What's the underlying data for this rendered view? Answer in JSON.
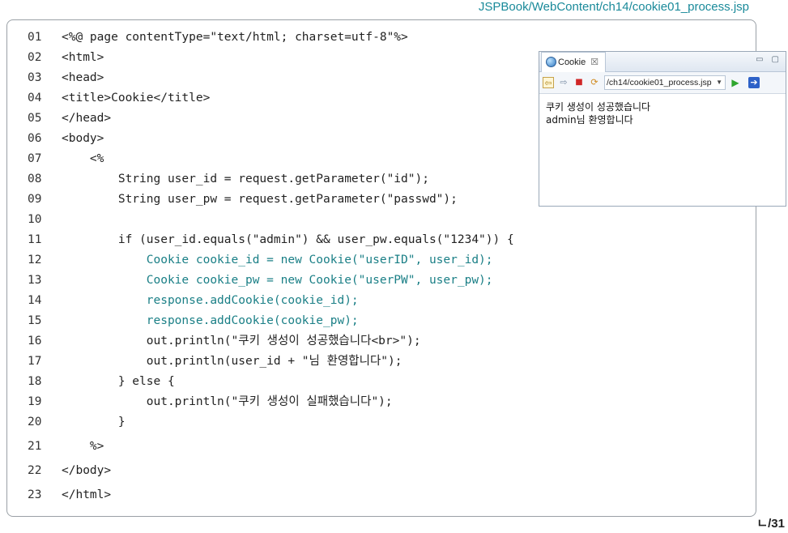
{
  "header": {
    "file_path": "JSPBook/WebContent/ch14/cookie01_process.jsp",
    "page_number": "ㄴ/31"
  },
  "code": {
    "lines": [
      {
        "no": "01",
        "text": "<%@ page contentType=\"text/html; charset=utf-8\"%>",
        "color": "default"
      },
      {
        "no": "02",
        "text": "<html>",
        "color": "default"
      },
      {
        "no": "03",
        "text": "<head>",
        "color": "default"
      },
      {
        "no": "04",
        "text": "<title>Cookie</title>",
        "color": "default"
      },
      {
        "no": "05",
        "text": "</head>",
        "color": "default"
      },
      {
        "no": "06",
        "text": "<body>",
        "color": "default"
      },
      {
        "no": "07",
        "text": "    <%",
        "color": "default"
      },
      {
        "no": "08",
        "text": "        String user_id = request.getParameter(\"id\");",
        "color": "default"
      },
      {
        "no": "09",
        "text": "        String user_pw = request.getParameter(\"passwd\");",
        "color": "default"
      },
      {
        "no": "10",
        "text": "",
        "color": "default"
      },
      {
        "no": "11",
        "text": "        if (user_id.equals(\"admin\") && user_pw.equals(\"1234\")) {",
        "color": "default"
      },
      {
        "no": "12",
        "text": "            Cookie cookie_id = new Cookie(\"userID\", user_id);",
        "color": "teal"
      },
      {
        "no": "13",
        "text": "            Cookie cookie_pw = new Cookie(\"userPW\", user_pw);",
        "color": "teal"
      },
      {
        "no": "14",
        "text": "            response.addCookie(cookie_id);",
        "color": "teal"
      },
      {
        "no": "15",
        "text": "            response.addCookie(cookie_pw);",
        "color": "teal"
      },
      {
        "no": "16",
        "text": "            out.println(\"쿠키 생성이 성공했습니다<br>\");",
        "color": "default"
      },
      {
        "no": "17",
        "text": "            out.println(user_id + \"님 환영합니다\");",
        "color": "default"
      },
      {
        "no": "18",
        "text": "        } else {",
        "color": "default"
      },
      {
        "no": "19",
        "text": "            out.println(\"쿠키 생성이 실패했습니다\");",
        "color": "default"
      },
      {
        "no": "20",
        "text": "        }",
        "color": "default"
      },
      {
        "no": "21",
        "text": "    %>",
        "color": "default"
      },
      {
        "no": "22",
        "text": "</body>",
        "color": "default"
      },
      {
        "no": "23",
        "text": "</html>",
        "color": "default"
      }
    ],
    "colors": {
      "default": "#222222",
      "teal": "#1a7f86"
    }
  },
  "browser": {
    "tab_label": "Cookie",
    "tab_close": "☒",
    "url": "/ch14/cookie01_process.jsp",
    "content_lines": [
      "쿠키 생성이 성공했습니다",
      "admin님 환영합니다"
    ],
    "icons": [
      "globe-icon",
      "back-icon",
      "forward-icon",
      "stop-icon",
      "refresh-icon",
      "go-icon",
      "external-browser-icon",
      "minimize-icon",
      "maximize-icon"
    ]
  }
}
